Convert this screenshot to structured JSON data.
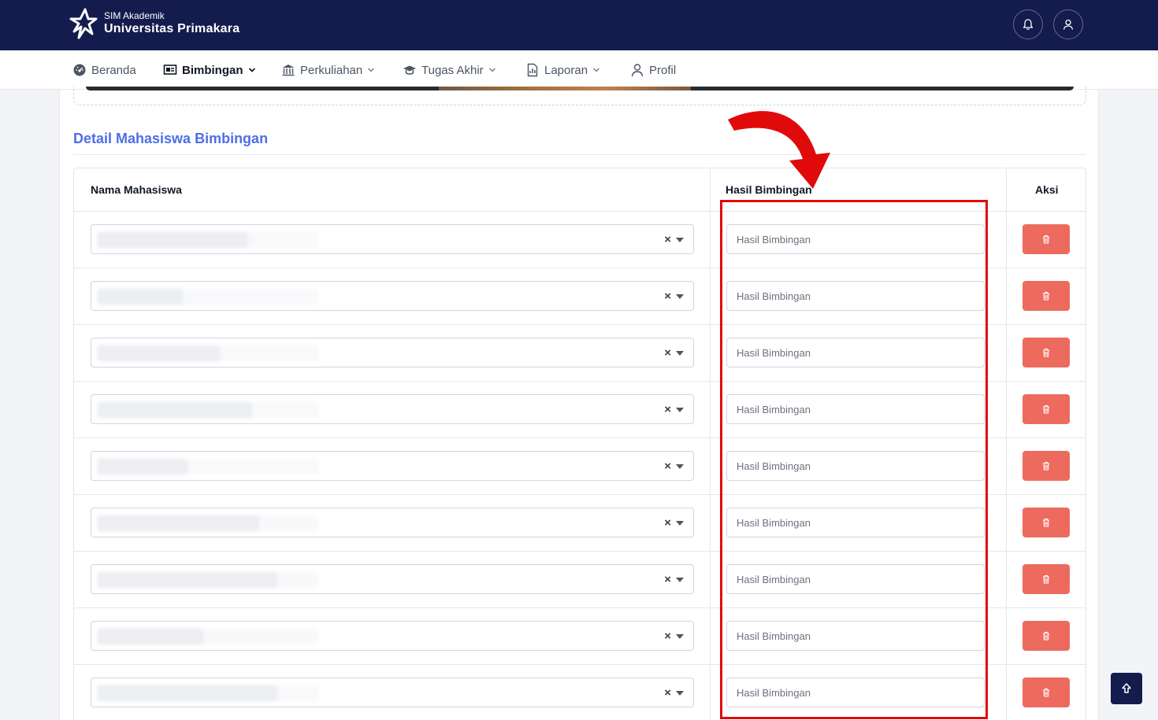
{
  "header": {
    "app_sub": "SIM Akademik",
    "app_title": "Universitas Primakara",
    "icons": [
      "bell-icon",
      "user-icon"
    ]
  },
  "nav": [
    {
      "label": "Beranda",
      "icon": "dashboard-icon",
      "has_dropdown": false,
      "active": false
    },
    {
      "label": "Bimbingan",
      "icon": "presentation-icon",
      "has_dropdown": true,
      "active": true
    },
    {
      "label": "Perkuliahan",
      "icon": "university-icon",
      "has_dropdown": true,
      "active": false
    },
    {
      "label": "Tugas Akhir",
      "icon": "graduation-cap-icon",
      "has_dropdown": true,
      "active": false
    },
    {
      "label": "Laporan",
      "icon": "report-icon",
      "has_dropdown": true,
      "active": false
    },
    {
      "label": "Profil",
      "icon": "user-icon",
      "has_dropdown": false,
      "active": false
    }
  ],
  "section": {
    "title": "Detail Mahasiswa Bimbingan"
  },
  "table": {
    "headers": {
      "student": "Nama Mahasiswa",
      "result": "Hasil Bimbingan",
      "action": "Aksi"
    },
    "rows": [
      {
        "student": "(blurred)",
        "result_placeholder": "Hasil Bimbingan"
      },
      {
        "student": "(blurred)",
        "result_placeholder": "Hasil Bimbingan"
      },
      {
        "student": "(blurred)",
        "result_placeholder": "Hasil Bimbingan"
      },
      {
        "student": "(blurred)",
        "result_placeholder": "Hasil Bimbingan"
      },
      {
        "student": "(blurred)",
        "result_placeholder": "Hasil Bimbingan"
      },
      {
        "student": "(blurred)",
        "result_placeholder": "Hasil Bimbingan"
      },
      {
        "student": "(blurred)",
        "result_placeholder": "Hasil Bimbingan"
      },
      {
        "student": "(blurred)",
        "result_placeholder": "Hasil Bimbingan"
      },
      {
        "student": "(blurred)",
        "result_placeholder": "Hasil Bimbingan"
      }
    ],
    "clear_glyph": "×",
    "delete_icon": "trash-icon"
  },
  "colors": {
    "header_bg": "#141b4d",
    "accent_title": "#4f6ee6",
    "delete_button": "#ec6b5e",
    "annotation_red": "#e10a0a"
  }
}
